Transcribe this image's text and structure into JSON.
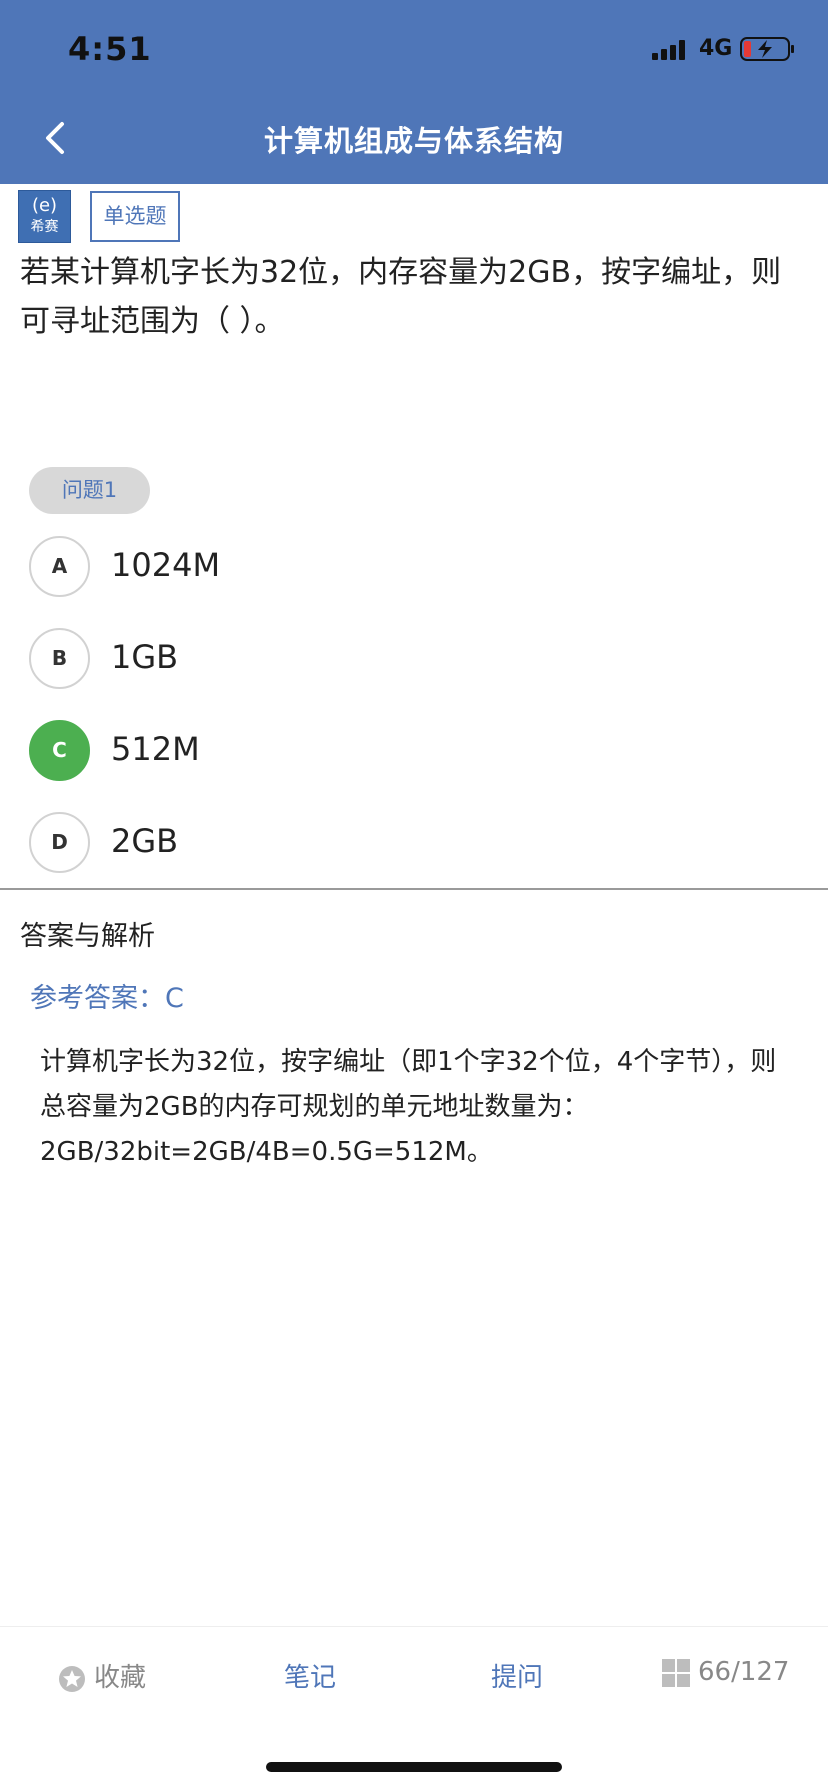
{
  "status_bar": {
    "time": "4:51",
    "network": "4G"
  },
  "nav": {
    "title": "计算机组成与体系结构"
  },
  "logo": {
    "text_top": "(e)",
    "text_bottom": "希赛"
  },
  "question": {
    "type": "单选题",
    "text": "若某计算机字长为32位，内存容量为2GB，按字编址，则可寻址范围为（ ）。",
    "tag": "问题1",
    "options": [
      {
        "letter": "A",
        "text": "1024M",
        "selected": false
      },
      {
        "letter": "B",
        "text": "1GB",
        "selected": false
      },
      {
        "letter": "C",
        "text": "512M",
        "selected": true
      },
      {
        "letter": "D",
        "text": "2GB",
        "selected": false
      }
    ]
  },
  "analysis": {
    "title": "答案与解析",
    "reference_answer": "参考答案：C",
    "explanation": "计算机字长为32位，按字编址（即1个字32个位，4个字节），则总容量为2GB的内存可规划的单元地址数量为：2GB/32bit=2GB/4B=0.5G=512M。"
  },
  "bottom_bar": {
    "favorite": "收藏",
    "note": "笔记",
    "ask": "提问",
    "progress": "66/127"
  },
  "colors": {
    "header": "#4f76b8",
    "accent": "#4f76b8",
    "selected": "#4caf50"
  },
  "icons": [
    "back-chevron-icon",
    "signal-icon",
    "battery-charging-icon",
    "star-icon",
    "grid-icon"
  ]
}
